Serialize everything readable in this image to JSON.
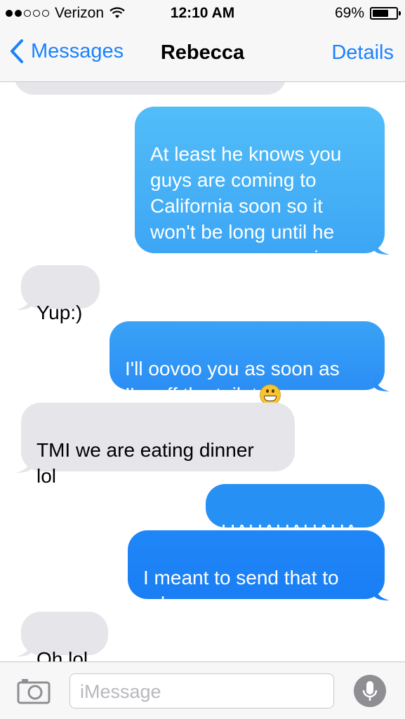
{
  "status_bar": {
    "carrier": "Verizon",
    "signal_bars_filled": 2,
    "signal_bars_total": 5,
    "time": "12:10 AM",
    "battery_percent": "69%",
    "battery_level": 0.69
  },
  "nav": {
    "back_label": "Messages",
    "title": "Rebecca",
    "details_label": "Details"
  },
  "colors": {
    "accent": "#1a82fb",
    "received_bubble": "#e5e5ea"
  },
  "messages": [
    {
      "type": "received",
      "text": ""
    },
    {
      "type": "sent",
      "text": "At least he knows you\nguys are coming to\nCalifornia soon so it\nwon't be long until he\nsees you guys again"
    },
    {
      "type": "received",
      "text": "Yup:)"
    },
    {
      "type": "sent",
      "text": "I'll oovoo you as soon as\nI'm off the toilet",
      "emoji": "grinning-face"
    },
    {
      "type": "received",
      "text": "TMI we are eating dinner\nlol"
    },
    {
      "type": "sent",
      "text": "HAHAHAHAHA"
    },
    {
      "type": "sent",
      "text": "I meant to send that to\nrob"
    },
    {
      "type": "received",
      "text": "Oh lol"
    }
  ],
  "input_bar": {
    "placeholder": "iMessage",
    "camera_icon": "camera-icon",
    "mic_icon": "microphone-icon"
  }
}
